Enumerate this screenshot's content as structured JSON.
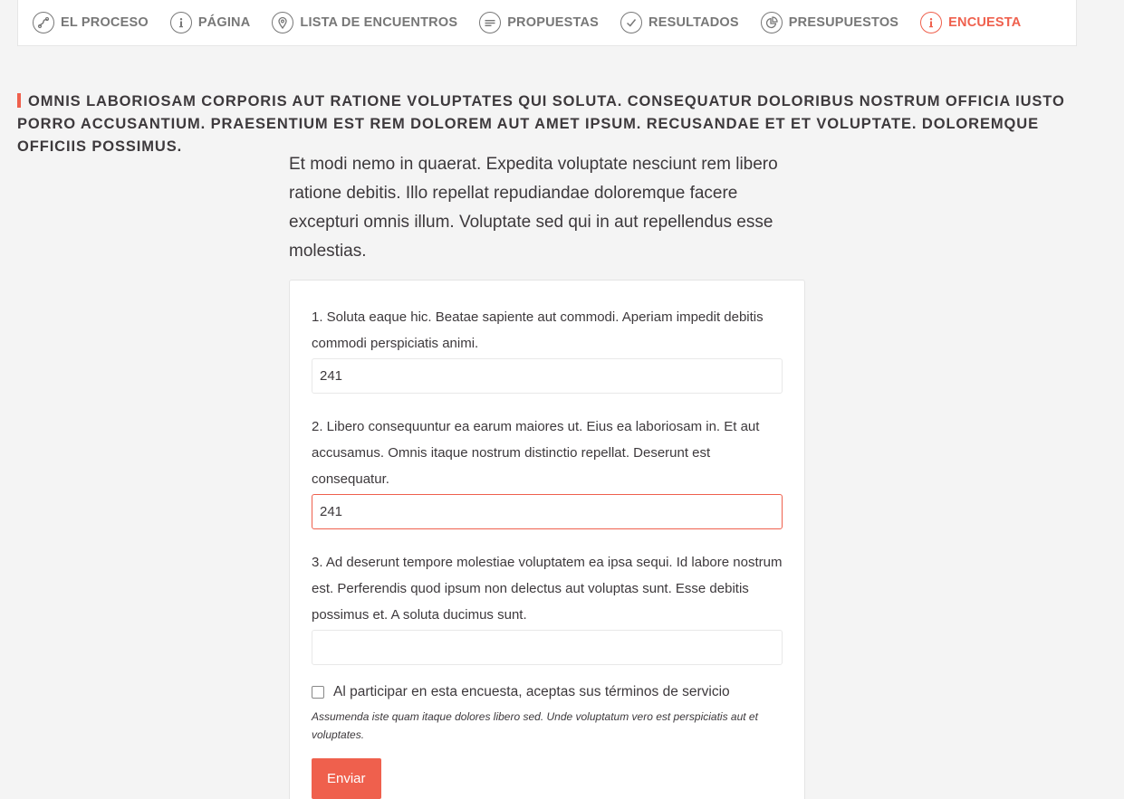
{
  "nav": {
    "items": [
      {
        "label": "EL PROCESO",
        "icon": "process-icon",
        "active": false
      },
      {
        "label": "PÁGINA",
        "icon": "info-icon",
        "active": false
      },
      {
        "label": "LISTA DE ENCUENTROS",
        "icon": "map-pin-icon",
        "active": false
      },
      {
        "label": "PROPUESTAS",
        "icon": "proposals-icon",
        "active": false
      },
      {
        "label": "RESULTADOS",
        "icon": "check-icon",
        "active": false
      },
      {
        "label": "PRESUPUESTOS",
        "icon": "pie-chart-icon",
        "active": false
      },
      {
        "label": "ENCUESTA",
        "icon": "info-icon",
        "active": true
      }
    ]
  },
  "colors": {
    "accent": "#ef604d",
    "text": "#3d393c",
    "muted": "#777777"
  },
  "survey": {
    "title": "OMNIS LABORIOSAM CORPORIS AUT RATIONE VOLUPTATES QUI SOLUTA. CONSEQUATUR DOLORIBUS NOSTRUM OFFICIA IUSTO PORRO ACCUSANTIUM. PRAESENTIUM EST REM DOLOREM AUT AMET IPSUM. RECUSANDAE ET ET VOLUPTATE. DOLOREMQUE OFFICIIS POSSIMUS.",
    "description": "Et modi nemo in quaerat. Expedita voluptate nesciunt rem libero ratione debitis. Illo repellat repudiandae doloremque facere excepturi omnis illum. Voluptate sed qui in aut repellendus esse molestias.",
    "questions": [
      {
        "label": "1. Soluta eaque hic. Beatae sapiente aut commodi. Aperiam impedit debitis commodi perspiciatis animi.",
        "value": "241"
      },
      {
        "label": "2. Libero consequuntur ea earum maiores ut. Eius ea laboriosam in. Et aut accusamus. Omnis itaque nostrum distinctio repellat. Deserunt est consequatur.",
        "value": "241"
      },
      {
        "label": "3. Ad deserunt tempore molestiae voluptatem ea ipsa sequi. Id labore nostrum est. Perferendis quod ipsum non delectus aut voluptas sunt. Esse debitis possimus et. A soluta ducimus sunt.",
        "value": ""
      }
    ],
    "tos_label": "Al participar en esta encuesta, aceptas sus términos de servicio",
    "tos_checked": false,
    "tos_help": "Assumenda iste quam itaque dolores libero sed. Unde voluptatum vero est perspiciatis aut et voluptates.",
    "submit_label": "Enviar"
  }
}
